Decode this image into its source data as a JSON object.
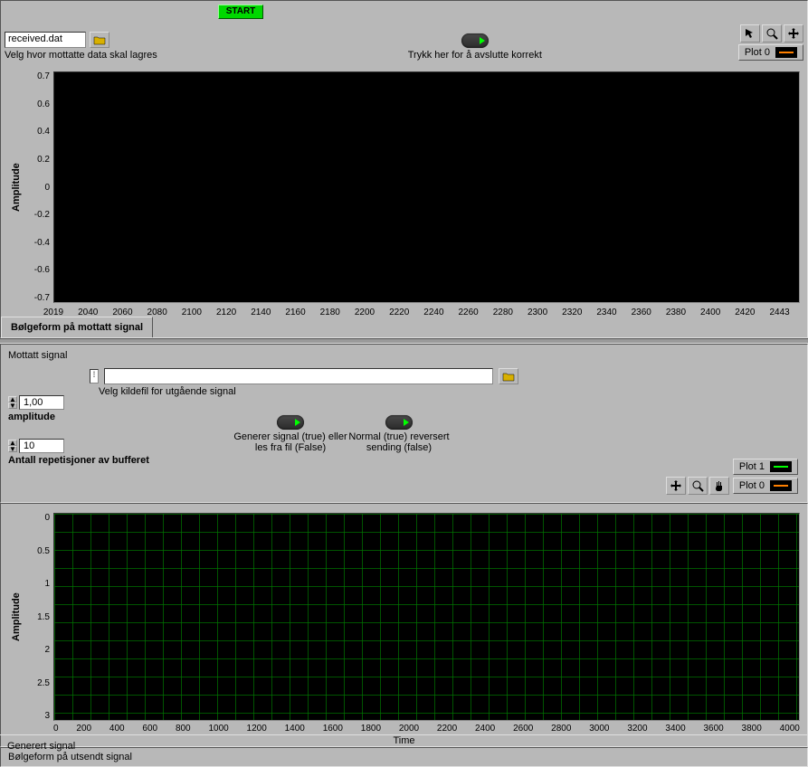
{
  "top": {
    "start_label": "START",
    "file_input": "received.dat",
    "file_caption": "Velg hvor mottatte data skal lagres",
    "stop_caption": "Trykk her for å avslutte korrekt",
    "legend_label": "Plot 0",
    "tab_label": "Bølgeform på mottatt signal"
  },
  "middle": {
    "section_title": "Mottatt signal",
    "source_label": "Velg kildefil for utgående signal",
    "source_value": "",
    "amplitude_label": "amplitude",
    "amplitude_value": "1,00",
    "repeat_label": "Antall repetisjoner av bufferet",
    "repeat_value": "10",
    "gen_label": "Generer signal (true) eller les fra fil (False)",
    "rev_label": "Normal (true) reversert sending (false)",
    "legend0": "Plot 0",
    "legend1": "Plot 1"
  },
  "bottom": {
    "xlabel": "Time",
    "footer": "Bølgeform på utsendt signal"
  },
  "general_title": "Generert signal",
  "chart_data": [
    {
      "id": "received",
      "type": "line",
      "title": "Bølgeform på mottatt signal",
      "ylabel": "Amplitude",
      "xlim": [
        2019,
        2443
      ],
      "ylim": [
        -0.7,
        0.7
      ],
      "xticks": [
        2019,
        2040,
        2060,
        2080,
        2100,
        2120,
        2140,
        2160,
        2180,
        2200,
        2220,
        2240,
        2260,
        2280,
        2300,
        2320,
        2340,
        2360,
        2380,
        2400,
        2420,
        2443
      ],
      "yticks": [
        -0.7,
        -0.6,
        -0.4,
        -0.2,
        0.0,
        0.2,
        0.4,
        0.6,
        0.7
      ],
      "series": [
        {
          "name": "Plot 0",
          "color": "#ff8000",
          "values": []
        }
      ]
    },
    {
      "id": "transmitted",
      "type": "line",
      "title": "Bølgeform på utsendt signal",
      "xlabel": "Time",
      "ylabel": "Amplitude",
      "xlim": [
        0,
        4000
      ],
      "ylim": [
        0.0,
        3.0
      ],
      "xticks": [
        0,
        200,
        400,
        600,
        800,
        1000,
        1200,
        1400,
        1600,
        1800,
        2000,
        2200,
        2400,
        2600,
        2800,
        3000,
        3200,
        3400,
        3600,
        3800,
        4000
      ],
      "yticks": [
        0.0,
        0.5,
        1.0,
        1.5,
        2.0,
        2.5,
        3.0
      ],
      "grid": true,
      "series": [
        {
          "name": "Plot 0",
          "color": "#ff8000",
          "values": []
        },
        {
          "name": "Plot 1",
          "color": "#00ff00",
          "values": []
        }
      ]
    }
  ]
}
